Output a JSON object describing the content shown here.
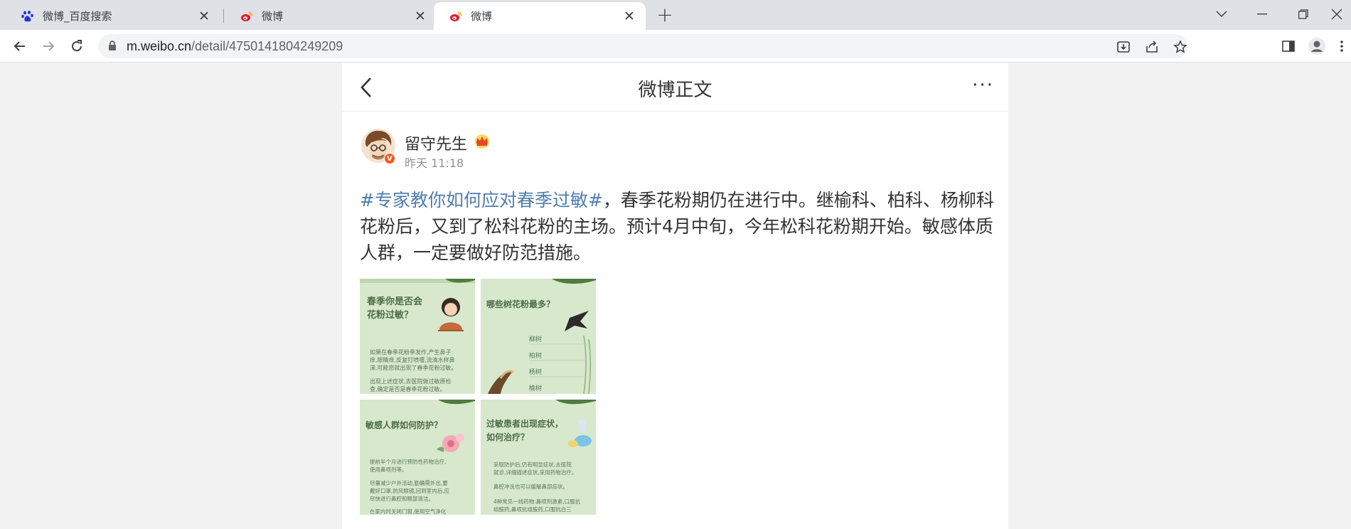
{
  "browser": {
    "tabs": [
      {
        "title": "微博_百度搜索",
        "icon": "baidu-paw-icon",
        "active": false
      },
      {
        "title": "微博",
        "icon": "weibo-icon",
        "active": false
      },
      {
        "title": "微博",
        "icon": "weibo-icon",
        "active": true
      }
    ],
    "url_host": "m.weibo.cn",
    "url_path": "/detail/4750141804249209"
  },
  "page": {
    "title": "微博正文",
    "more_label": "···"
  },
  "post": {
    "author": "留守先生",
    "verified_badge": "V",
    "time": "昨天 11:18",
    "hashtag": "#专家教你如何应对春季过敏#",
    "body": "，春季花粉期仍在进行中。继榆科、柏科、杨柳科花粉后，又到了松科花粉的主场。预计4月中旬，今年松科花粉期开始。敏感体质人群，一定要做好防范措施。",
    "images": [
      {
        "heading1": "春季你是否会",
        "heading2": "花粉过敏？",
        "lines": [
          "如果在春季花粉季发作,产生鼻子",
          "痒,眼睛痒,反复打喷嚏,流清水样鼻",
          "涕,可能您就出现了春季花粉过敏。",
          "",
          "出现上述症状,去医院做过敏原检",
          "查,确定是否是春季花粉过敏。"
        ]
      },
      {
        "heading1": "哪些树花粉最多？",
        "heading2": "",
        "lines": [
          "柳树",
          "柏树",
          "杨树",
          "榆树"
        ]
      },
      {
        "heading1": "敏感人群如何防护？",
        "heading2": "",
        "lines": [
          "提前半个月进行预防性药物治疗,",
          "使用鼻喷剂等。",
          "",
          "尽量减少户外活动,勤确需外出,要",
          "戴好口罩,防风眼镜,回到室内后,应",
          "尽快进行鼻腔和眼部清洁。",
          "",
          "在家内时关闭门窗,使用空气净化"
        ]
      },
      {
        "heading1": "过敏患者出现症状，",
        "heading2": "如何治疗？",
        "lines": [
          "采取防护后,仍有明显症状,去医院",
          "就诊,详细描述症状,采用药物治疗。",
          "",
          "鼻腔冲洗也可以缓解鼻部症状。",
          "",
          "4种常见一线药物:鼻喷剂激素,口服抗",
          "组胺药,鼻喷抗组胺药,口服抗白三"
        ]
      }
    ]
  },
  "colors": {
    "accent_link": "#507daf",
    "tab_strip": "#dee1e6",
    "thumb_green": "#d7e8cd",
    "thumb_text": "#5a7a55"
  }
}
